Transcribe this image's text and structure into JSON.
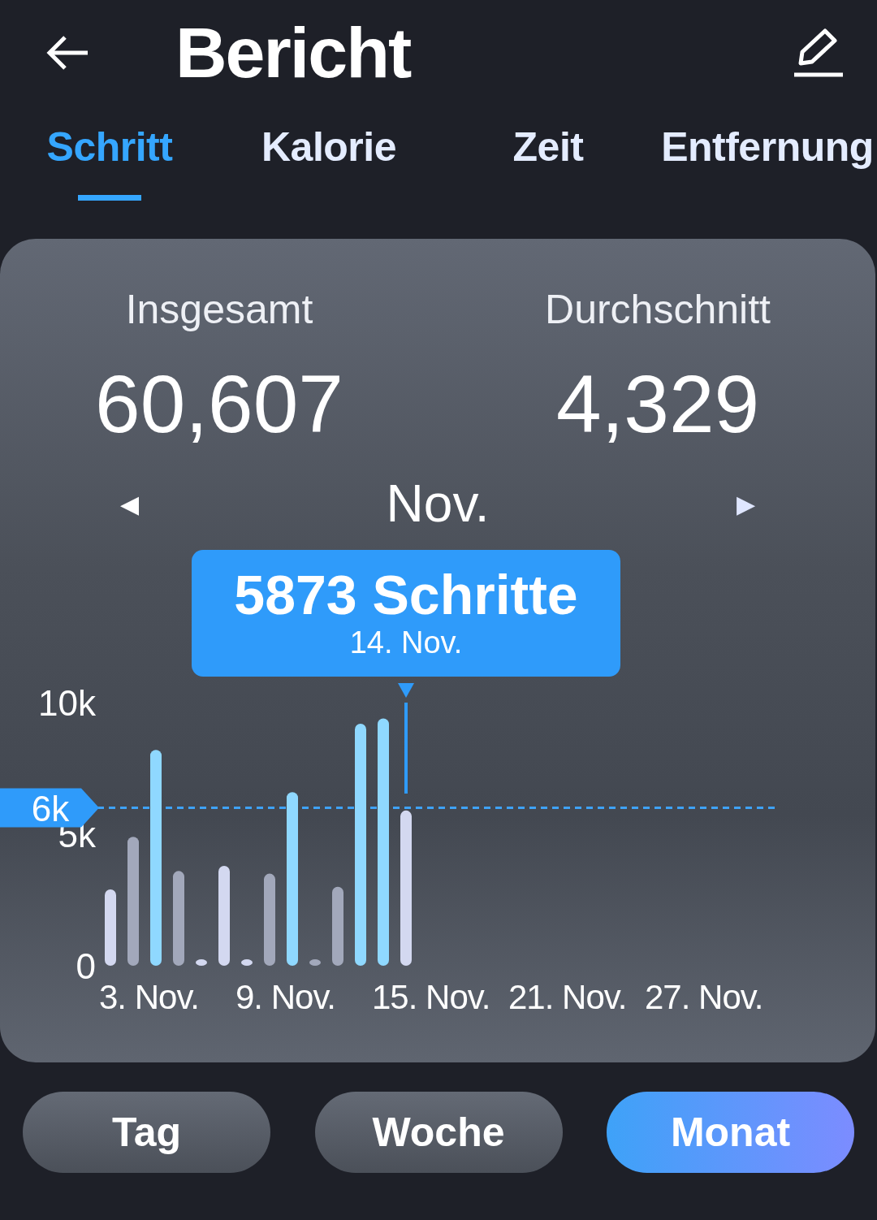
{
  "header": {
    "title": "Bericht"
  },
  "tabs": [
    {
      "label": "Schritt",
      "selected": true
    },
    {
      "label": "Kalorie",
      "selected": false
    },
    {
      "label": "Zeit",
      "selected": false
    },
    {
      "label": "Entfernung",
      "selected": false
    }
  ],
  "summary": [
    {
      "label": "Insgesamt",
      "value": "60,607"
    },
    {
      "label": "Durchschnitt",
      "value": "4,329"
    }
  ],
  "period": {
    "prev": "◀",
    "label": "Nov.",
    "next": "▶"
  },
  "tooltip": {
    "value": "5873 Schritte",
    "date": "14. Nov."
  },
  "chart_data": {
    "type": "bar",
    "categories": [
      null,
      null,
      "3. Nov.",
      null,
      null,
      null,
      null,
      null,
      "9. Nov.",
      null,
      null,
      null,
      null,
      null,
      "15. Nov.",
      null,
      null,
      null,
      null,
      null,
      "21. Nov.",
      null,
      null,
      null,
      null,
      null,
      "27. Nov.",
      null,
      null,
      null
    ],
    "series": [
      {
        "color": "#8fd8ff",
        "values": [
          null,
          null,
          8200,
          null,
          null,
          null,
          null,
          null,
          6600,
          null,
          null,
          9200,
          9400,
          null,
          null,
          null,
          null,
          null,
          null,
          null,
          null,
          null,
          null,
          null,
          null,
          null,
          null,
          null,
          null,
          null
        ]
      },
      {
        "color": "#d3d8f0",
        "values": [
          2900,
          null,
          null,
          null,
          100,
          3800,
          100,
          null,
          null,
          null,
          null,
          null,
          null,
          5900,
          null,
          null,
          null,
          null,
          null,
          null,
          null,
          null,
          null,
          null,
          null,
          null,
          null,
          null,
          null,
          null
        ]
      },
      {
        "color": "#a2a8bb",
        "values": [
          null,
          4900,
          null,
          3600,
          null,
          null,
          null,
          3500,
          null,
          200,
          3000,
          null,
          null,
          null,
          null,
          null,
          null,
          null,
          null,
          null,
          null,
          null,
          null,
          null,
          null,
          null,
          null,
          null,
          null,
          null
        ]
      }
    ],
    "ylim": [
      0,
      10000
    ],
    "yticks": [
      0,
      {
        "value": 5000,
        "label": "5k"
      },
      {
        "value": 10000,
        "label": "10k"
      }
    ],
    "ref_lines": [
      {
        "axis": "y",
        "value": 6000,
        "label": "6k",
        "color": "#3ea2f8"
      }
    ]
  },
  "ranges": [
    {
      "label": "Tag",
      "selected": false
    },
    {
      "label": "Woche",
      "selected": false
    },
    {
      "label": "Monat",
      "selected": true
    }
  ]
}
